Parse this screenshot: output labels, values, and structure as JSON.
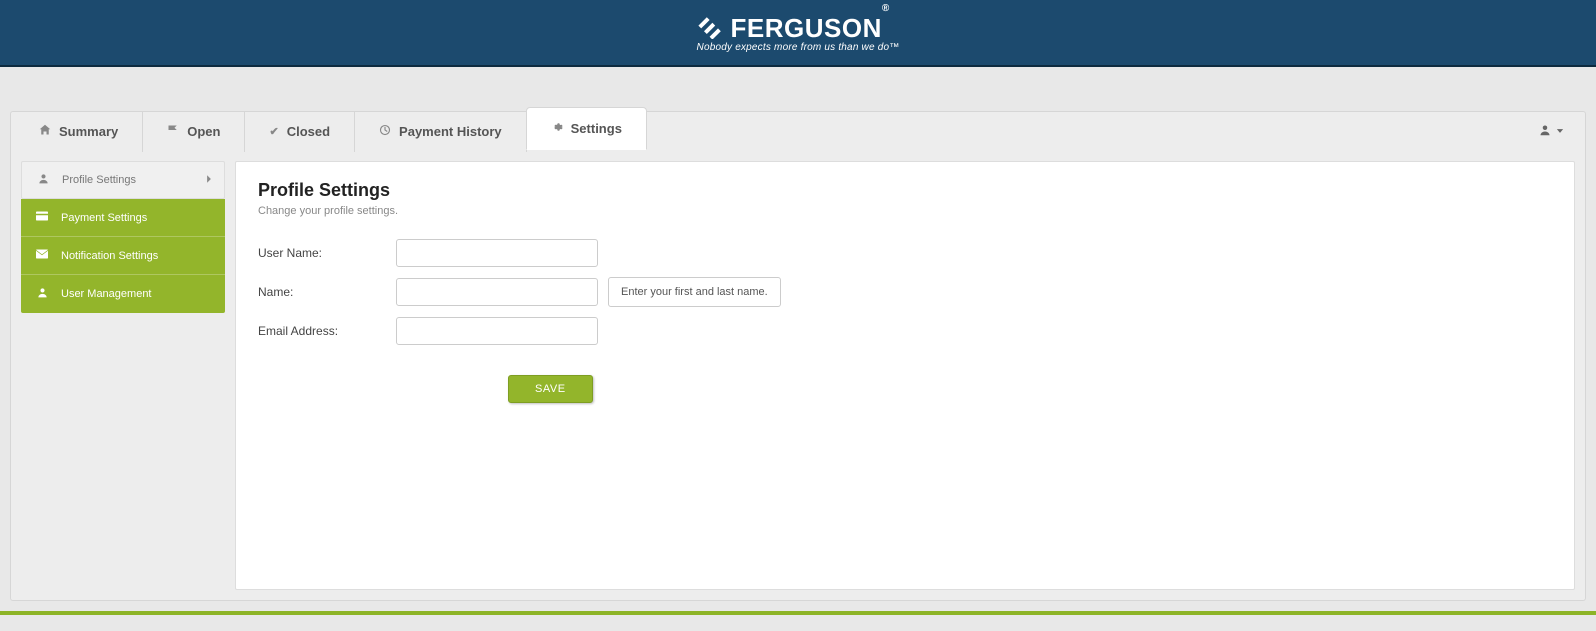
{
  "brand": {
    "name": "FERGUSON",
    "tagline": "Nobody expects more from us than we do™"
  },
  "tabs": {
    "summary": "Summary",
    "open": "Open",
    "closed": "Closed",
    "payment_history": "Payment History",
    "settings": "Settings"
  },
  "sidebar": {
    "profile": "Profile Settings",
    "payment": "Payment Settings",
    "notification": "Notification Settings",
    "user_mgmt": "User Management"
  },
  "panel": {
    "title": "Profile Settings",
    "subtitle": "Change your profile settings."
  },
  "form": {
    "username_label": "User Name:",
    "username_value": "",
    "name_label": "Name:",
    "name_value": "",
    "name_hint": "Enter your first and last name.",
    "email_label": "Email Address:",
    "email_value": "",
    "save_label": "SAVE"
  }
}
